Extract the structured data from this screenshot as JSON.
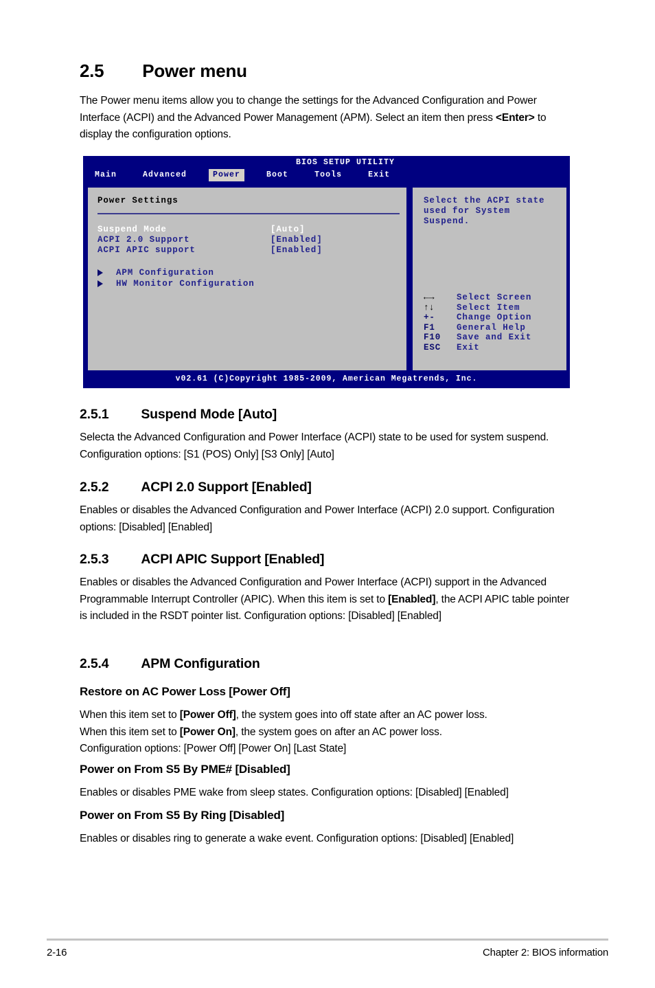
{
  "document": {
    "section_number": "2.5",
    "section_title": "Power menu",
    "intro_part1": "The Power menu items allow you to change the settings for the Advanced Configuration and Power Interface (ACPI) and the Advanced Power Management (APM). Select an item then press ",
    "intro_bold": "<Enter>",
    "intro_part2": " to display the configuration options."
  },
  "bios": {
    "utility_title": "BIOS SETUP UTILITY",
    "tabs": [
      {
        "label": "Main",
        "active": false
      },
      {
        "label": "Advanced",
        "active": false
      },
      {
        "label": "Power",
        "active": true
      },
      {
        "label": "Boot",
        "active": false
      },
      {
        "label": "Tools",
        "active": false
      },
      {
        "label": "Exit",
        "active": false
      }
    ],
    "panel_title": "Power Settings",
    "options": [
      {
        "name": "Suspend Mode",
        "value": "[Auto]",
        "selected": true
      },
      {
        "name": "ACPI 2.0 Support",
        "value": "[Enabled]",
        "selected": false
      },
      {
        "name": "ACPI APIC support",
        "value": "[Enabled]",
        "selected": false
      }
    ],
    "submenus": [
      {
        "label": "APM Configuration"
      },
      {
        "label": "HW Monitor Configuration"
      }
    ],
    "help_text": "Select the ACPI state used for System Suspend.",
    "legend": [
      {
        "key": "←→",
        "desc": "Select Screen",
        "glyph": true
      },
      {
        "key": "↑↓",
        "desc": "Select Item",
        "glyph": true
      },
      {
        "key": "+-",
        "desc": "Change Option",
        "glyph": false
      },
      {
        "key": "F1",
        "desc": "General Help",
        "glyph": false
      },
      {
        "key": "F10",
        "desc": "Save and Exit",
        "glyph": false
      },
      {
        "key": "ESC",
        "desc": "Exit",
        "glyph": false
      }
    ],
    "footer": "v02.61 (C)Copyright 1985-2009, American Megatrends, Inc.",
    "colors": {
      "chrome": "#000080",
      "panel": "#c0c0c0",
      "text": "#22228c",
      "selected_text": "#ffffff",
      "active_tab_bg": "#d4d0c8"
    }
  },
  "sections": {
    "s251": {
      "number": "2.5.1",
      "title": "Suspend Mode [Auto]",
      "body": "Selecta the Advanced Configuration and Power Interface (ACPI) state to be used for system suspend. Configuration options: [S1 (POS) Only] [S3 Only] [Auto]"
    },
    "s252": {
      "number": "2.5.2",
      "title": "ACPI 2.0 Support [Enabled]",
      "body": "Enables or disables the Advanced Configuration and Power Interface (ACPI) 2.0 support. Configuration options: [Disabled] [Enabled]"
    },
    "s253": {
      "number": "2.5.3",
      "title": "ACPI APIC Support [Enabled]",
      "body_part1": "Enables or disables the Advanced Configuration and Power Interface (ACPI) support in the Advanced Programmable Interrupt Controller (APIC). When this item is set to ",
      "body_bold": "[Enabled]",
      "body_part2": ", the ACPI APIC table pointer is included in the RSDT pointer list. Configuration options: [Disabled] [Enabled]"
    },
    "s254": {
      "number": "2.5.4",
      "title": "APM Configuration",
      "sub1": {
        "heading": "Restore on AC Power Loss [Power Off]",
        "line1_part1": "When this item set to ",
        "line1_bold": "[Power Off]",
        "line1_part2": ", the system goes into off state after an AC power loss.",
        "line2_part1": "When this item set to ",
        "line2_bold": "[Power On]",
        "line2_part2": ", the system goes on after an AC power loss.",
        "line3": "Configuration options: [Power Off] [Power On] [Last State]"
      },
      "sub2": {
        "heading": "Power on From S5 By PME# [Disabled]",
        "body": "Enables or disables PME wake from sleep states. Configuration options: [Disabled] [Enabled]"
      },
      "sub3": {
        "heading": "Power on From S5 By Ring [Disabled]",
        "body": "Enables or disables ring to generate a wake event. Configuration options: [Disabled] [Enabled]"
      }
    }
  },
  "footer": {
    "page_number": "2-16",
    "chapter": "Chapter 2: BIOS information"
  }
}
